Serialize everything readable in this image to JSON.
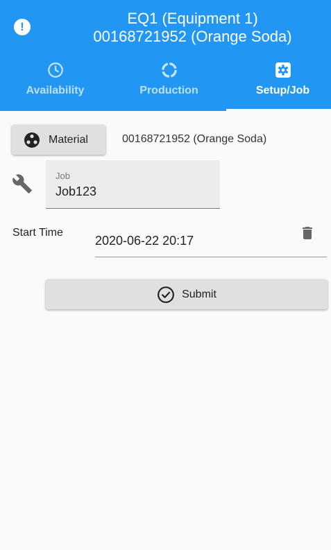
{
  "header": {
    "title_line1": "EQ1 (Equipment 1)",
    "title_line2": "00168721952 (Orange Soda)",
    "alert_icon": "alert-circle-icon"
  },
  "tabs": [
    {
      "label": "Availability",
      "icon": "clock-icon",
      "active": false
    },
    {
      "label": "Production",
      "icon": "progress-ring-icon",
      "active": false
    },
    {
      "label": "Setup/Job",
      "icon": "gear-icon",
      "active": true
    }
  ],
  "material": {
    "button_label": "Material",
    "value": "00168721952 (Orange Soda)"
  },
  "job": {
    "label": "Job",
    "value": "Job123"
  },
  "start_time": {
    "label": "Start Time",
    "value": "2020-06-22 20:17"
  },
  "submit": {
    "label": "Submit"
  },
  "colors": {
    "primary": "#2196f3",
    "primary_dark": "#1976d2",
    "button_bg": "#e0e0e0",
    "icon_gray": "#666666"
  }
}
